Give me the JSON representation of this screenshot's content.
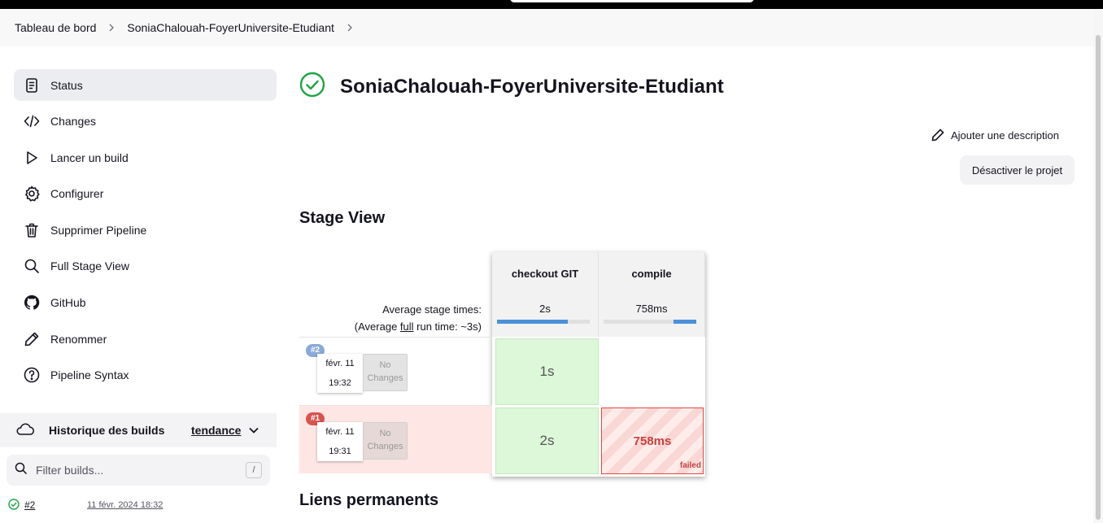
{
  "breadcrumb": [
    "Tableau de bord",
    "SoniaChalouah-FoyerUniversite-Etudiant"
  ],
  "sidebar": {
    "items": [
      {
        "label": "Status",
        "icon": "status-icon"
      },
      {
        "label": "Changes",
        "icon": "code-icon"
      },
      {
        "label": "Lancer un build",
        "icon": "play-icon"
      },
      {
        "label": "Configurer",
        "icon": "gear-icon"
      },
      {
        "label": "Supprimer Pipeline",
        "icon": "trash-icon"
      },
      {
        "label": "Full Stage View",
        "icon": "search-icon"
      },
      {
        "label": "GitHub",
        "icon": "github-icon"
      },
      {
        "label": "Renommer",
        "icon": "pencil-icon"
      },
      {
        "label": "Pipeline Syntax",
        "icon": "help-icon"
      }
    ]
  },
  "history": {
    "title": "Historique des builds",
    "trend": "tendance",
    "filter_placeholder": "Filter builds...",
    "filter_shortcut": "/",
    "builds": [
      {
        "number": "#2",
        "date": "11 févr. 2024 18:32"
      }
    ]
  },
  "main": {
    "title": "SoniaChalouah-FoyerUniversite-Etudiant",
    "add_description": "Ajouter une description",
    "disable_project": "Désactiver le projet",
    "stage_view_title": "Stage View",
    "permalinks_title": "Liens permanents"
  },
  "stage_view": {
    "stages": [
      "checkout GIT",
      "compile"
    ],
    "avg_label": "Average stage times:",
    "avg_full_prefix": "(Average ",
    "avg_full_link": "full",
    "avg_full_suffix": " run time: ~3s)",
    "avg_times": [
      "2s",
      "758ms"
    ],
    "avg_progress": [
      0.76,
      0.25
    ],
    "runs": [
      {
        "badge": "#2",
        "date": "févr. 11",
        "time": "19:32",
        "changes": "No Changes",
        "status": "success",
        "cells": [
          "1s",
          ""
        ]
      },
      {
        "badge": "#1",
        "date": "févr. 11",
        "time": "19:31",
        "changes": "No Changes",
        "status": "failed",
        "cells": [
          "2s",
          "758ms"
        ],
        "failed_label": "failed"
      }
    ]
  },
  "colors": {
    "success": "#1ea446",
    "failed": "#e04848",
    "badge_success": "#8aa8d8",
    "badge_failed": "#d9534f"
  }
}
